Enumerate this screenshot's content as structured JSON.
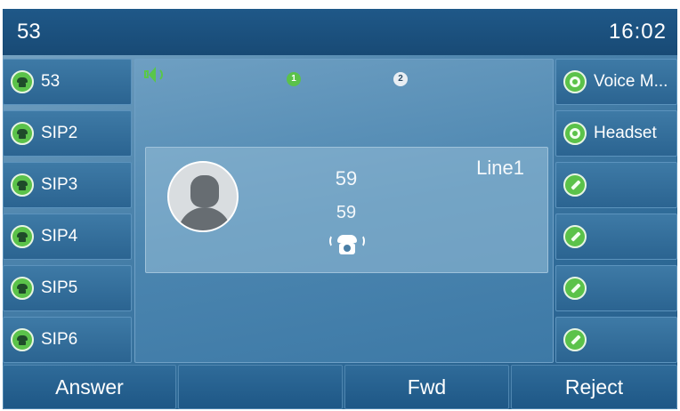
{
  "title_bar": {
    "account": "53",
    "time": "16:02"
  },
  "left_line_keys": [
    {
      "label": "53",
      "icon": "phone-icon"
    },
    {
      "label": "SIP2",
      "icon": "phone-icon"
    },
    {
      "label": "SIP3",
      "icon": "phone-icon"
    },
    {
      "label": "SIP4",
      "icon": "phone-icon"
    },
    {
      "label": "SIP5",
      "icon": "phone-icon"
    },
    {
      "label": "SIP6",
      "icon": "phone-icon"
    }
  ],
  "right_line_keys": [
    {
      "label": "Voice M...",
      "icon": "radio-icon"
    },
    {
      "label": "Headset",
      "icon": "radio-icon"
    },
    {
      "label": "",
      "icon": "edit-icon"
    },
    {
      "label": "",
      "icon": "edit-icon"
    },
    {
      "label": "",
      "icon": "edit-icon"
    },
    {
      "label": "",
      "icon": "edit-icon"
    }
  ],
  "call": {
    "page_indicators": [
      "1",
      "2"
    ],
    "caller_name": "59",
    "caller_number": "59",
    "line": "Line1",
    "state_icon": "ringing-phone-icon",
    "audio_icon": "speaker-icon"
  },
  "soft_keys": [
    {
      "label": "Answer"
    },
    {
      "label": ""
    },
    {
      "label": "Fwd"
    },
    {
      "label": "Reject"
    }
  ],
  "colors": {
    "status_green": "#5bc24a",
    "title_bar": "#1f5888",
    "panel_blue": "#4c86b0"
  }
}
